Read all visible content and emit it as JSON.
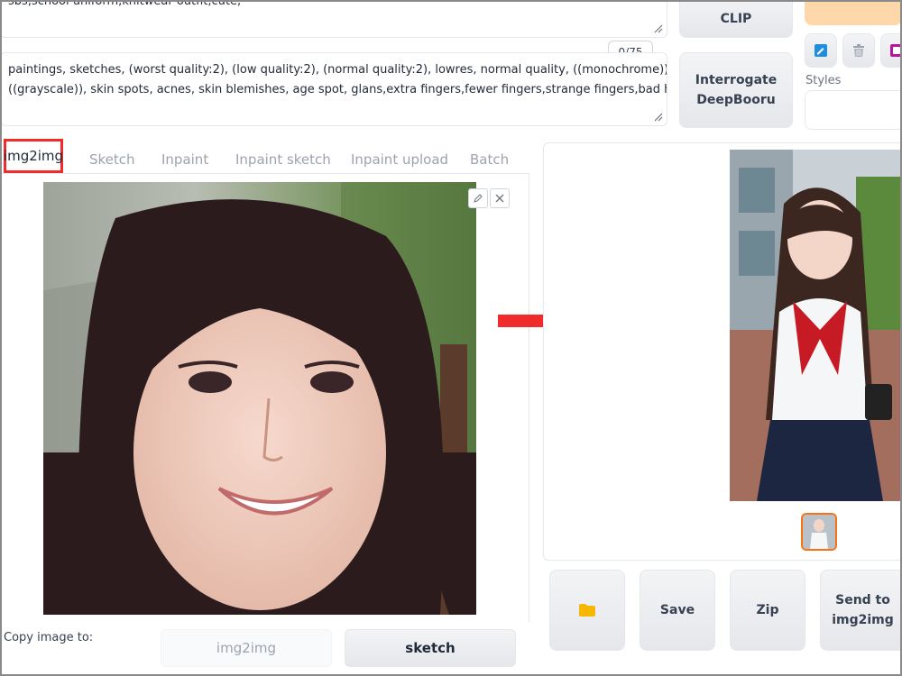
{
  "prompt": {
    "top_partial": "sbs,school uniform,knitwear outfit,cute,",
    "negative_line1": "paintings, sketches, (worst quality:2), (low quality:2), (normal quality:2), lowres, normal quality, ((monochrome)),",
    "negative_line2": "((grayscale)), skin spots, acnes, skin blemishes, age spot, glans,extra fingers,fewer fingers,strange fingers,bad hand, overbite,",
    "token_counter": "0/75"
  },
  "interrogate": {
    "clip_label": "CLIP",
    "deepbooru_label": "Interrogate\nDeepBooru"
  },
  "styles": {
    "label": "Styles"
  },
  "tabs": [
    {
      "label": "img2img",
      "active": true
    },
    {
      "label": "Sketch"
    },
    {
      "label": "Inpaint"
    },
    {
      "label": "Inpaint sketch"
    },
    {
      "label": "Inpaint upload"
    },
    {
      "label": "Batch"
    }
  ],
  "copy_image": {
    "label": "Copy image to:",
    "img2img_label": "img2img",
    "sketch_label": "sketch"
  },
  "output_actions": {
    "save_label": "Save",
    "zip_label": "Zip",
    "send_label": "Send to\nimg2img"
  },
  "colors": {
    "highlight": "#ef2b2b",
    "thumb_border": "#f97316",
    "accent_orange": "#fed7aa"
  }
}
